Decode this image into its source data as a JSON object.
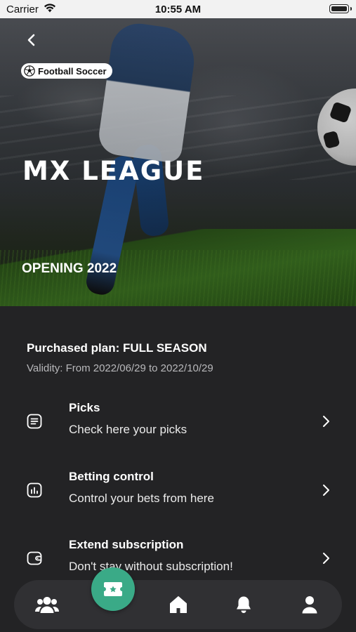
{
  "status_bar": {
    "carrier": "Carrier",
    "time": "10:55 AM"
  },
  "hero": {
    "category_chip": "Football Soccer",
    "league_title": "MX LEAGUE",
    "season_label": "OPENING 2022"
  },
  "plan": {
    "title": "Purchased plan: FULL SEASON",
    "validity": "Validity: From 2022/06/29 to 2022/10/29"
  },
  "menu": [
    {
      "title": "Picks",
      "subtitle": "Check here your picks",
      "icon": "list-icon"
    },
    {
      "title": "Betting control",
      "subtitle": "Control your bets from here",
      "icon": "chart-icon"
    },
    {
      "title": "Extend subscription",
      "subtitle": "Don't stay without subscription!",
      "icon": "wallet-icon"
    }
  ],
  "bottom_nav": {
    "items": [
      "users-icon",
      "ticket-icon",
      "home-icon",
      "bell-icon",
      "profile-icon"
    ],
    "fab_color": "#3aaa87"
  },
  "colors": {
    "background": "#232325",
    "nav_background": "#303033",
    "accent": "#3aaa87"
  }
}
